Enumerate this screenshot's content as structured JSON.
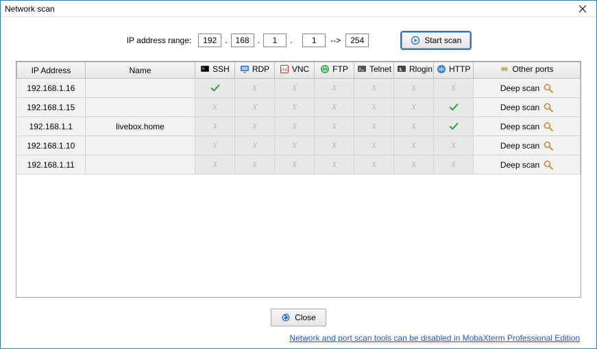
{
  "window": {
    "title": "Network scan"
  },
  "range": {
    "label": "IP address range:",
    "octets": [
      "192",
      "168",
      "1"
    ],
    "from": "1",
    "to": "254",
    "arrow": "-->"
  },
  "buttons": {
    "start_scan": "Start scan",
    "close": "Close"
  },
  "columns": {
    "ip": "IP Address",
    "name": "Name",
    "ssh": "SSH",
    "rdp": "RDP",
    "vnc": "VNC",
    "ftp": "FTP",
    "telnet": "Telnet",
    "rlogin": "Rlogin",
    "http": "HTTP",
    "other": "Other ports"
  },
  "icons": {
    "ssh": "ssh-icon",
    "rdp": "rdp-icon",
    "vnc": "vnc-icon",
    "ftp": "ftp-icon",
    "telnet": "telnet-icon",
    "rlogin": "rlogin-icon",
    "http": "http-icon",
    "other": "port-icon",
    "play": "play-icon",
    "magnifier": "magnifier-icon",
    "refresh": "refresh-icon"
  },
  "deep_scan_label": "Deep scan",
  "rows": [
    {
      "ip": "192.168.1.16",
      "name": "",
      "ssh": true,
      "rdp": false,
      "vnc": false,
      "ftp": false,
      "telnet": false,
      "rlogin": false,
      "http": false
    },
    {
      "ip": "192.168.1.15",
      "name": "",
      "ssh": false,
      "rdp": false,
      "vnc": false,
      "ftp": false,
      "telnet": false,
      "rlogin": false,
      "http": true
    },
    {
      "ip": "192.168.1.1",
      "name": "livebox.home",
      "ssh": false,
      "rdp": false,
      "vnc": false,
      "ftp": false,
      "telnet": false,
      "rlogin": false,
      "http": true
    },
    {
      "ip": "192.168.1.10",
      "name": "",
      "ssh": false,
      "rdp": false,
      "vnc": false,
      "ftp": false,
      "telnet": false,
      "rlogin": false,
      "http": false
    },
    {
      "ip": "192.168.1.11",
      "name": "",
      "ssh": false,
      "rdp": false,
      "vnc": false,
      "ftp": false,
      "telnet": false,
      "rlogin": false,
      "http": false
    }
  ],
  "footer": {
    "link_text": "Network and port scan tools can be disabled in MobaXterm Professional Edition"
  }
}
